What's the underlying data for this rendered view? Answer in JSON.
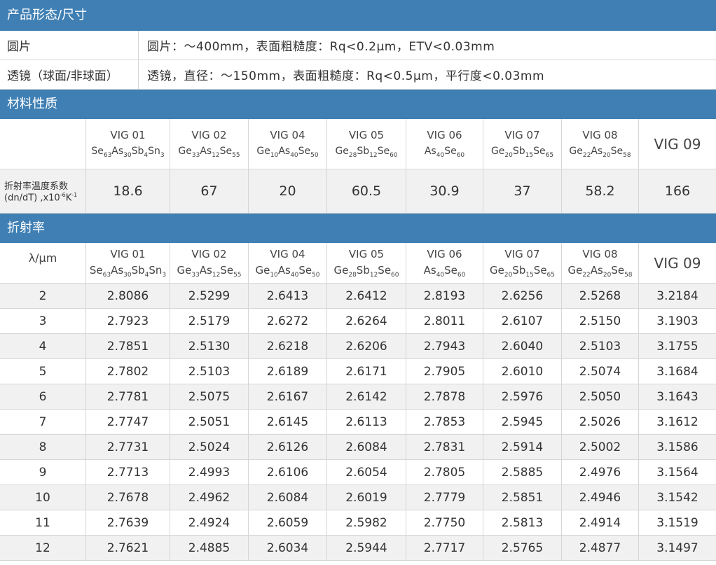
{
  "sections": {
    "dimensions": "产品形态/尺寸",
    "properties": "材料性质",
    "refractive": "折射率"
  },
  "dimensions": [
    {
      "label": "圆片",
      "value": "圆片：～400mm，表面粗糙度：Rq<0.2μm，ETV<0.03mm"
    },
    {
      "label": "透镜（球面/非球面）",
      "value": "透镜，直径：～150mm，表面粗糙度：Rq<0.5μm，平行度<0.03mm"
    }
  ],
  "materials": [
    {
      "name": "VIG 01",
      "formula": [
        [
          "Se",
          "63"
        ],
        [
          "As",
          "30"
        ],
        [
          "Sb",
          "4"
        ],
        [
          "Sn",
          "3"
        ]
      ]
    },
    {
      "name": "VIG 02",
      "formula": [
        [
          "Ge",
          "33"
        ],
        [
          "As",
          "12"
        ],
        [
          "Se",
          "55"
        ]
      ]
    },
    {
      "name": "VIG 04",
      "formula": [
        [
          "Ge",
          "10"
        ],
        [
          "As",
          "40"
        ],
        [
          "Se",
          "50"
        ]
      ]
    },
    {
      "name": "VIG 05",
      "formula": [
        [
          "Ge",
          "28"
        ],
        [
          "Sb",
          "12"
        ],
        [
          "Se",
          "60"
        ]
      ]
    },
    {
      "name": "VIG 06",
      "formula": [
        [
          "As",
          "40"
        ],
        [
          "Se",
          "60"
        ]
      ]
    },
    {
      "name": "VIG 07",
      "formula": [
        [
          "Ge",
          "20"
        ],
        [
          "Sb",
          "15"
        ],
        [
          "Se",
          "65"
        ]
      ]
    },
    {
      "name": "VIG 08",
      "formula": [
        [
          "Ge",
          "22"
        ],
        [
          "As",
          "20"
        ],
        [
          "Se",
          "58"
        ]
      ]
    },
    {
      "name": "VIG 09",
      "formula": []
    }
  ],
  "thermal": {
    "label_line1": "折射率温度系数",
    "label_line2_pre": "(dn/dT) ,x10",
    "label_exp1": "-6",
    "label_mid": "K",
    "label_exp2": "-1",
    "values": [
      "18.6",
      "67",
      "20",
      "60.5",
      "30.9",
      "37",
      "58.2",
      "166"
    ]
  },
  "refractive": {
    "wavelength_header": "λ/μm",
    "rows": [
      {
        "wl": "2",
        "v": [
          "2.8086",
          "2.5299",
          "2.6413",
          "2.6412",
          "2.8193",
          "2.6256",
          "2.5268",
          "3.2184"
        ]
      },
      {
        "wl": "3",
        "v": [
          "2.7923",
          "2.5179",
          "2.6272",
          "2.6264",
          "2.8011",
          "2.6107",
          "2.5150",
          "3.1903"
        ]
      },
      {
        "wl": "4",
        "v": [
          "2.7851",
          "2.5130",
          "2.6218",
          "2.6206",
          "2.7943",
          "2.6040",
          "2.5103",
          "3.1755"
        ]
      },
      {
        "wl": "5",
        "v": [
          "2.7802",
          "2.5103",
          "2.6189",
          "2.6171",
          "2.7905",
          "2.6010",
          "2.5074",
          "3.1684"
        ]
      },
      {
        "wl": "6",
        "v": [
          "2.7781",
          "2.5075",
          "2.6167",
          "2.6142",
          "2.7878",
          "2.5976",
          "2.5050",
          "3.1643"
        ]
      },
      {
        "wl": "7",
        "v": [
          "2.7747",
          "2.5051",
          "2.6145",
          "2.6113",
          "2.7853",
          "2.5945",
          "2.5026",
          "3.1612"
        ]
      },
      {
        "wl": "8",
        "v": [
          "2.7731",
          "2.5024",
          "2.6126",
          "2.6084",
          "2.7831",
          "2.5914",
          "2.5002",
          "3.1586"
        ]
      },
      {
        "wl": "9",
        "v": [
          "2.7713",
          "2.4993",
          "2.6106",
          "2.6054",
          "2.7805",
          "2.5885",
          "2.4976",
          "3.1564"
        ]
      },
      {
        "wl": "10",
        "v": [
          "2.7678",
          "2.4962",
          "2.6084",
          "2.6019",
          "2.7779",
          "2.5851",
          "2.4946",
          "3.1542"
        ]
      },
      {
        "wl": "11",
        "v": [
          "2.7639",
          "2.4924",
          "2.6059",
          "2.5982",
          "2.7750",
          "2.5813",
          "2.4914",
          "3.1519"
        ]
      },
      {
        "wl": "12",
        "v": [
          "2.7621",
          "2.4885",
          "2.6034",
          "2.5944",
          "2.7717",
          "2.5765",
          "2.4877",
          "3.1497"
        ]
      }
    ]
  },
  "colors": {
    "header_bg": "#3f7fb3",
    "stripe": "#f1f1f1"
  }
}
